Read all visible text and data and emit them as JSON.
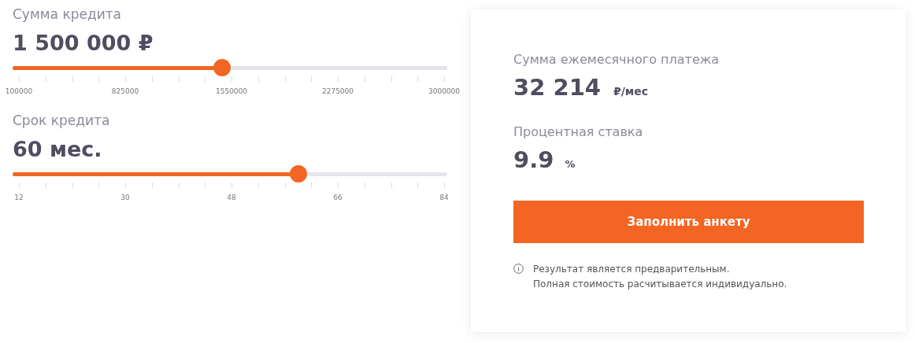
{
  "sliders": [
    {
      "label": "Сумма кредита",
      "value": "1 500 000 ₽",
      "level": 0.482,
      "ticks": [
        "100000",
        "825000",
        "1550000",
        "2275000",
        "3000000"
      ]
    },
    {
      "label": "Срок кредита",
      "value": "60 мес.",
      "level": 0.658,
      "ticks": [
        "12",
        "30",
        "48",
        "66",
        "84"
      ]
    }
  ],
  "result": {
    "payment_label": "Сумма ежемесячного платежа",
    "payment_value": "32 214",
    "payment_unit": "₽/мес",
    "rate_label": "Процентная ставка",
    "rate_value": "9.9",
    "rate_unit": "%",
    "button": "Заполнить анкету",
    "note_lines": [
      "Результат является предварительным.",
      "Полная стоимость расчитывается индивидуально."
    ]
  }
}
